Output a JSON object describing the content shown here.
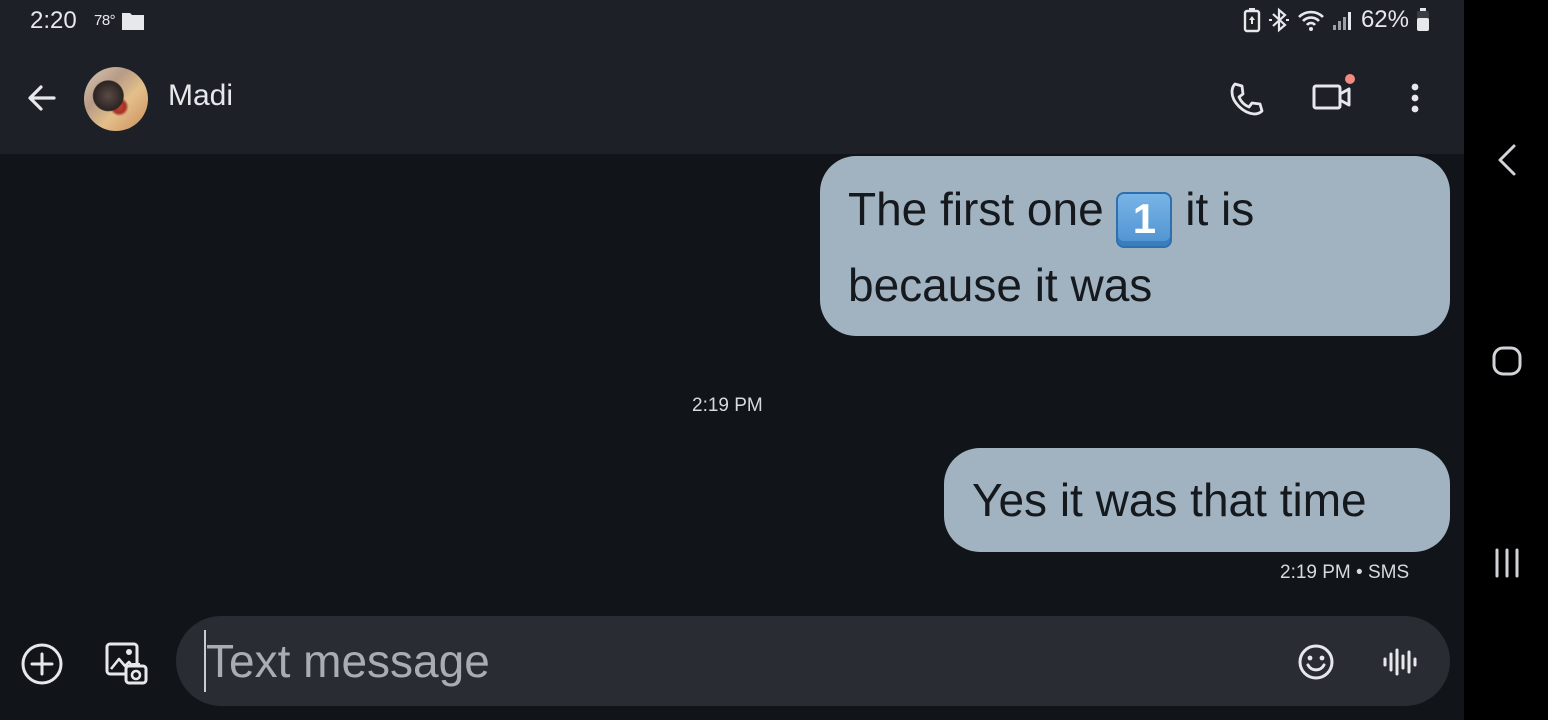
{
  "status_bar": {
    "time": "2:20",
    "temperature": "78°",
    "battery_percent": "62%",
    "icons": [
      "folder-icon",
      "battery-saver-icon",
      "bluetooth-icon",
      "wifi-icon",
      "signal-icon",
      "battery-icon"
    ]
  },
  "header": {
    "contact_name": "Madi",
    "actions": [
      "back-icon",
      "phone-icon",
      "video-call-icon",
      "more-vert-icon"
    ],
    "video_badge_color": "#f28b82"
  },
  "conversation": {
    "messages": [
      {
        "text_before": "The first one",
        "emoji": "1",
        "text_after": " it is because it was",
        "direction": "outgoing"
      },
      {
        "text": "Yes it was that time",
        "direction": "outgoing"
      }
    ],
    "timestamps": [
      "2:19 PM",
      "2:19 PM • SMS"
    ]
  },
  "composer": {
    "placeholder": "Text message",
    "value": "",
    "icons": [
      "add-icon",
      "gallery-icon",
      "emoji-icon",
      "voice-icon"
    ]
  },
  "nav_bar": {
    "icons": [
      "nav-back-icon",
      "nav-home-icon",
      "nav-recents-icon"
    ]
  },
  "colors": {
    "background": "#111418",
    "app_bar": "#1d2026",
    "bubble": "#a1b3c1",
    "composer": "#292d33",
    "text_primary": "#e6e8ec"
  }
}
